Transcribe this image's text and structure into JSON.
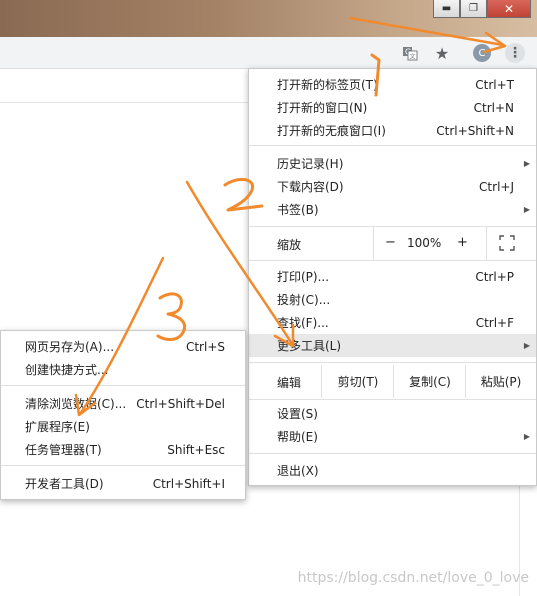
{
  "window_controls": {
    "minimize": "▬",
    "restore": "❐",
    "close": "✕"
  },
  "toolbar": {
    "translate_icon": "translate-icon",
    "star_icon": "★",
    "profile_initial": "C",
    "menu_icon": "⋮"
  },
  "main_menu": {
    "new_tab": {
      "label": "打开新的标签页(T)",
      "shortcut": "Ctrl+T"
    },
    "new_window": {
      "label": "打开新的窗口(N)",
      "shortcut": "Ctrl+N"
    },
    "incognito": {
      "label": "打开新的无痕窗口(I)",
      "shortcut": "Ctrl+Shift+N"
    },
    "history": {
      "label": "历史记录(H)"
    },
    "downloads": {
      "label": "下载内容(D)",
      "shortcut": "Ctrl+J"
    },
    "bookmarks": {
      "label": "书签(B)"
    },
    "zoom": {
      "label": "缩放",
      "minus": "−",
      "value": "100%",
      "plus": "+"
    },
    "print": {
      "label": "打印(P)...",
      "shortcut": "Ctrl+P"
    },
    "cast": {
      "label": "投射(C)..."
    },
    "find": {
      "label": "查找(F)...",
      "shortcut": "Ctrl+F"
    },
    "more_tools": {
      "label": "更多工具(L)"
    },
    "edit": {
      "label": "编辑",
      "cut": "剪切(T)",
      "copy": "复制(C)",
      "paste": "粘贴(P)"
    },
    "settings": {
      "label": "设置(S)"
    },
    "help": {
      "label": "帮助(E)"
    },
    "exit": {
      "label": "退出(X)"
    }
  },
  "sub_menu": {
    "save_page": {
      "label": "网页另存为(A)...",
      "shortcut": "Ctrl+S"
    },
    "create_shortcut": {
      "label": "创建快捷方式..."
    },
    "clear_data": {
      "label": "清除浏览数据(C)...",
      "shortcut": "Ctrl+Shift+Del"
    },
    "extensions": {
      "label": "扩展程序(E)"
    },
    "task_manager": {
      "label": "任务管理器(T)",
      "shortcut": "Shift+Esc"
    },
    "dev_tools": {
      "label": "开发者工具(D)",
      "shortcut": "Ctrl+Shift+I"
    }
  },
  "annotations": {
    "step1": "1",
    "step2": "2",
    "step3": "3",
    "color": "#f08a2c"
  },
  "watermark": "https://blog.csdn.net/love_0_love"
}
